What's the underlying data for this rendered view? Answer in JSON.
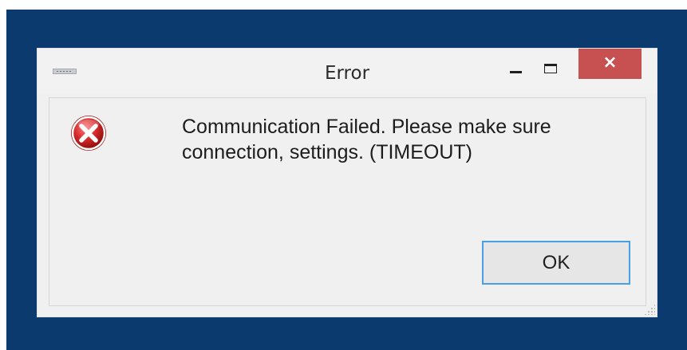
{
  "dialog": {
    "title": "Error",
    "message_line1": "Communication Failed. Please make sure",
    "message_line2": "connection, settings. (TIMEOUT)",
    "ok_label": "OK",
    "close_glyph": "×"
  },
  "icons": {
    "system_menu": "system-menu-icon",
    "error": "error-icon",
    "minimize": "minimize-icon",
    "maximize": "maximize-icon",
    "close": "close-icon",
    "resize": "resize-grip-icon"
  },
  "colors": {
    "desktop": "#0b3a6f",
    "close_button": "#c75050",
    "ok_focus_border": "#4a9ee4",
    "error_red": "#c81e1e"
  }
}
